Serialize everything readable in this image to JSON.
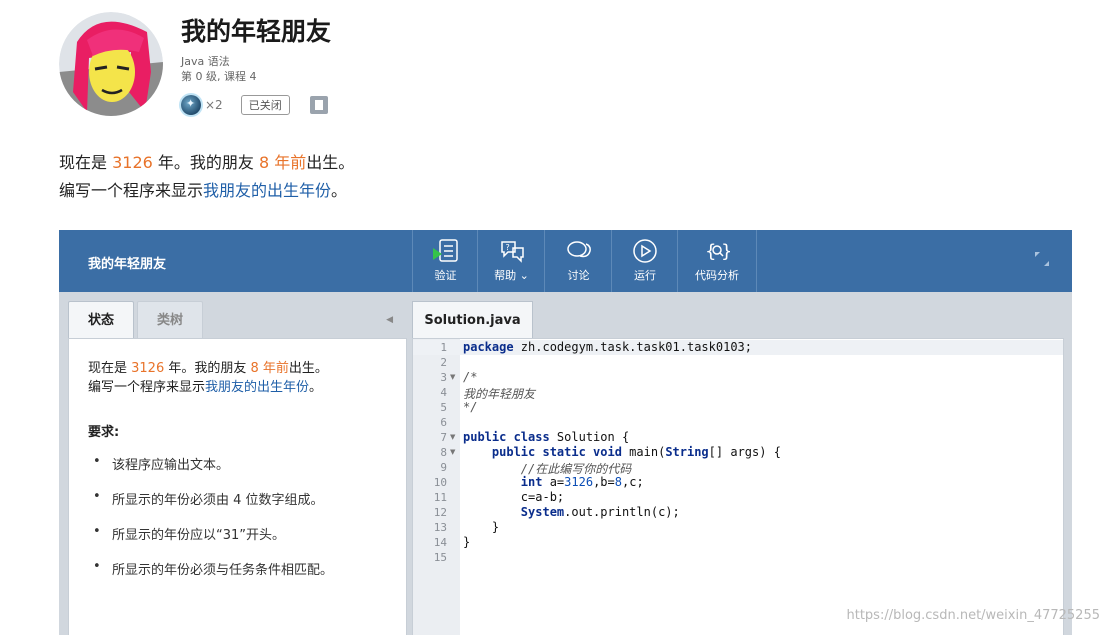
{
  "task": {
    "title": "我的年轻朋友",
    "course": "Java 语法",
    "level": "第 0 级, 课程 4",
    "award_count": "×2",
    "status_tag": "已关闭"
  },
  "description": {
    "line1_a": "现在是 ",
    "line1_year": "3126",
    "line1_b": " 年。我的朋友 ",
    "line1_ago": "8 年前",
    "line1_c": "出生。",
    "line2_a": "编写一个程序来显示",
    "line2_link": "我朋友的出生年份",
    "line2_b": "。"
  },
  "ide": {
    "name": "我的年轻朋友",
    "toolbar": [
      {
        "label": "验证",
        "icon": "verify-icon"
      },
      {
        "label": "帮助 ⌄",
        "icon": "help-icon"
      },
      {
        "label": "讨论",
        "icon": "discussion-icon"
      },
      {
        "label": "运行",
        "icon": "run-icon"
      },
      {
        "label": "代码分析",
        "icon": "code-analysis-icon"
      }
    ],
    "left_tabs": {
      "status": "状态",
      "tree": "类树"
    },
    "file_tab": "Solution.java"
  },
  "requirements": {
    "title": "要求:",
    "items": [
      "该程序应输出文本。",
      "所显示的年份必须由 4 位数字组成。",
      "所显示的年份应以“31”开头。",
      "所显示的年份必须与任务条件相匹配。"
    ]
  },
  "editor": {
    "line_numbers": [
      "1",
      "2",
      "3",
      "4",
      "5",
      "6",
      "7",
      "8",
      "9",
      "10",
      "11",
      "12",
      "13",
      "14",
      "15"
    ],
    "lines": [
      "package zh.codegym.task.task01.task0103;",
      "",
      "/*",
      "我的年轻朋友",
      "*/",
      "",
      "public class Solution {",
      "    public static void main(String[] args) {",
      "        //在此编写你的代码",
      "        int a=3126,b=8,c;",
      "        c=a-b;",
      "        System.out.println(c);",
      "    }",
      "}",
      ""
    ]
  },
  "watermark": "https://blog.csdn.net/weixin_47725255"
}
